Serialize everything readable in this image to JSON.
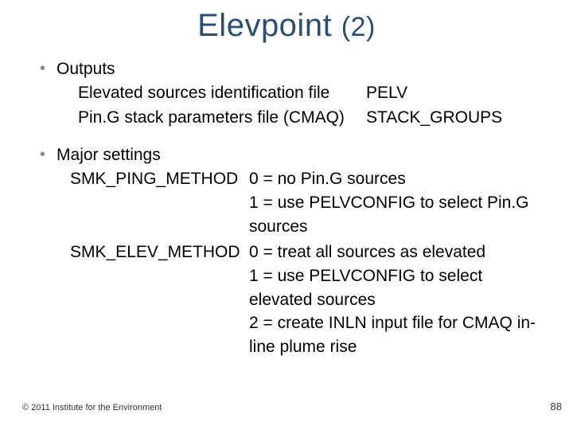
{
  "title_main": "Elevpoint ",
  "title_paren": "(2)",
  "outputs": {
    "label": "Outputs",
    "rows": [
      {
        "left": "Elevated sources identification file",
        "right": "PELV"
      },
      {
        "left": "Pin.G stack parameters file (CMAQ)",
        "right": "STACK_GROUPS"
      }
    ]
  },
  "settings": {
    "label": "Major settings",
    "rows": [
      {
        "left": "SMK_PING_METHOD",
        "lines": [
          "0 = no Pin.G sources",
          "1 = use PELVCONFIG to select Pin.G sources"
        ]
      },
      {
        "left": "SMK_ELEV_METHOD",
        "lines": [
          "0 = treat all sources as elevated",
          "1 = use PELVCONFIG to select elevated sources",
          "2 = create INLN input file for CMAQ in-line plume rise"
        ]
      }
    ]
  },
  "footer": {
    "copyright": "© 2011 Institute for the Environment",
    "page": "88"
  }
}
